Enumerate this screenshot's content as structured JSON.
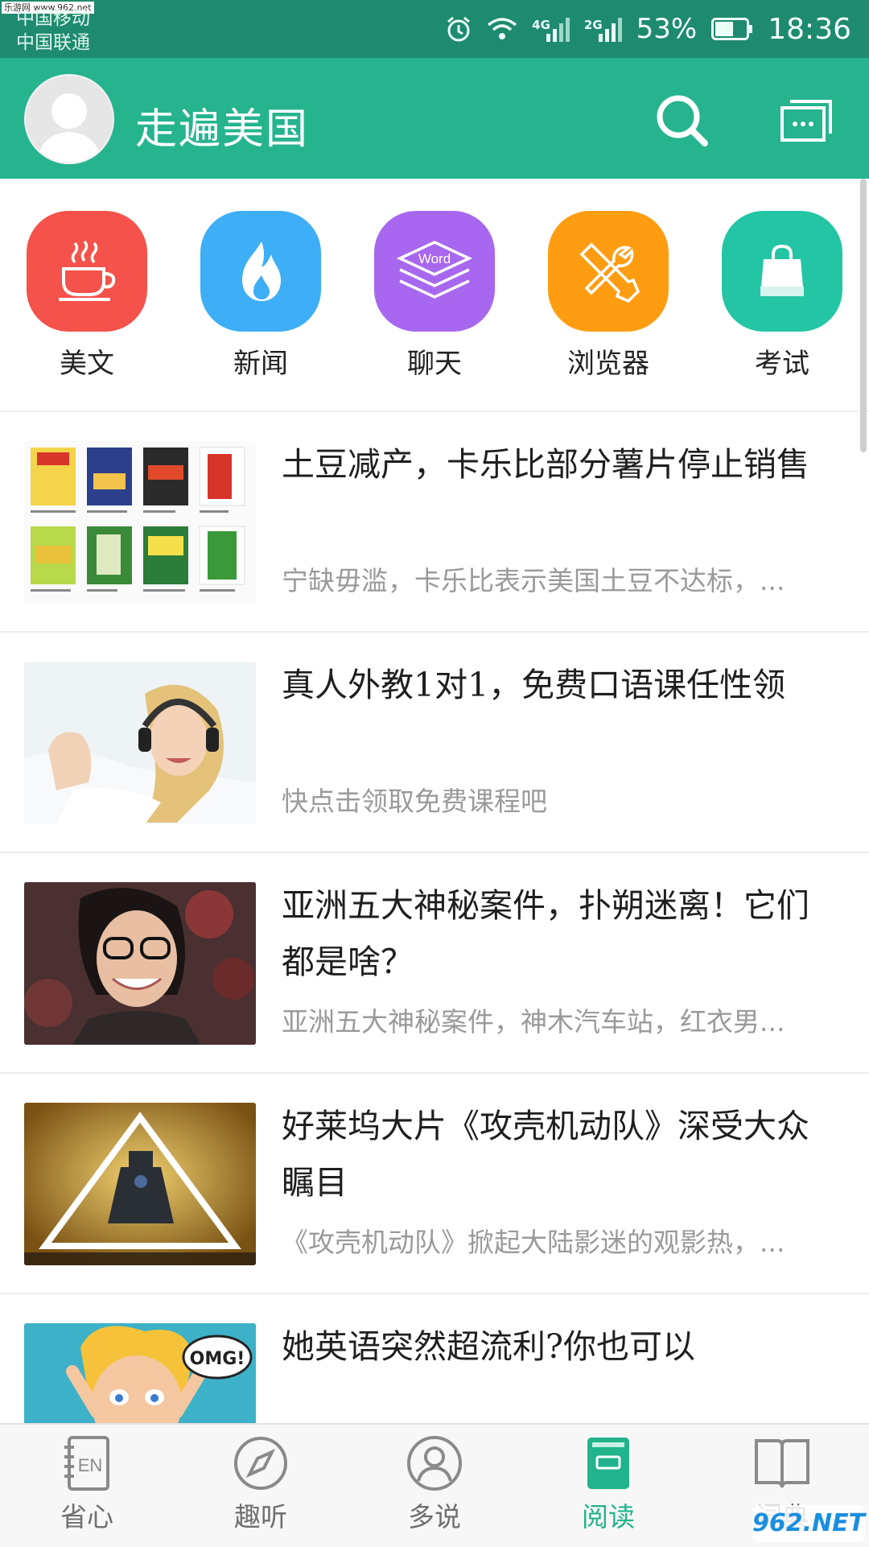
{
  "status_bar": {
    "watermark": "乐游网 www.962.net",
    "carrier_1": "中国移动",
    "carrier_2": "中国联通",
    "net_1": "4G",
    "net_2": "2G",
    "battery_pct": "53%",
    "time": "18:36"
  },
  "header": {
    "title": "走遍美国",
    "avatar_icon": "user-avatar-icon",
    "search_icon": "search-icon",
    "chat_icon": "chat-icon"
  },
  "categories": [
    {
      "label": "美文",
      "color": "#f4524a",
      "icon": "coffee-cup-icon"
    },
    {
      "label": "新闻",
      "color": "#3eaef7",
      "icon": "flame-icon"
    },
    {
      "label": "聊天",
      "color": "#a867ef",
      "icon": "word-stack-icon",
      "icon_text": "Word"
    },
    {
      "label": "浏览器",
      "color": "#ff9d12",
      "icon": "tools-icon"
    },
    {
      "label": "考试",
      "color": "#23c5a4",
      "icon": "bag-icon"
    }
  ],
  "articles": [
    {
      "title": "土豆减产，卡乐比部分薯片停止销售",
      "subtitle": "宁缺毋滥，卡乐比表示美国土豆不达标，...",
      "thumb": "chips-grid"
    },
    {
      "title": "真人外教1对1，免费口语课任性领",
      "subtitle": "快点击领取免费课程吧",
      "thumb": "girl-headphones"
    },
    {
      "title": "亚洲五大神秘案件，扑朔迷离！它们都是啥？",
      "subtitle": "亚洲五大神秘案件，神木汽车站，红衣男...",
      "thumb": "woman-glasses"
    },
    {
      "title": "好莱坞大片《攻壳机动队》深受大众瞩目",
      "subtitle": "《攻壳机动队》掀起大陆影迷的观影热，...",
      "thumb": "movie-poster"
    },
    {
      "title": "她英语突然超流利?你也可以",
      "subtitle": "",
      "thumb": "omg-comic",
      "thumb_text": "OMG!"
    }
  ],
  "bottom_nav": [
    {
      "label": "省心",
      "icon": "en-notebook-icon",
      "active": false
    },
    {
      "label": "趣听",
      "icon": "compass-icon",
      "active": false
    },
    {
      "label": "多说",
      "icon": "person-icon",
      "active": false
    },
    {
      "label": "阅读",
      "icon": "book-reading-icon",
      "active": true
    },
    {
      "label": "词典",
      "icon": "open-book-icon",
      "active": false
    }
  ],
  "colors": {
    "status_bar": "#1e8a6e",
    "header": "#26b48f",
    "accent": "#21b38c",
    "subtitle_gray": "#9a9a9a"
  },
  "watermark_bottom": "962.NET"
}
